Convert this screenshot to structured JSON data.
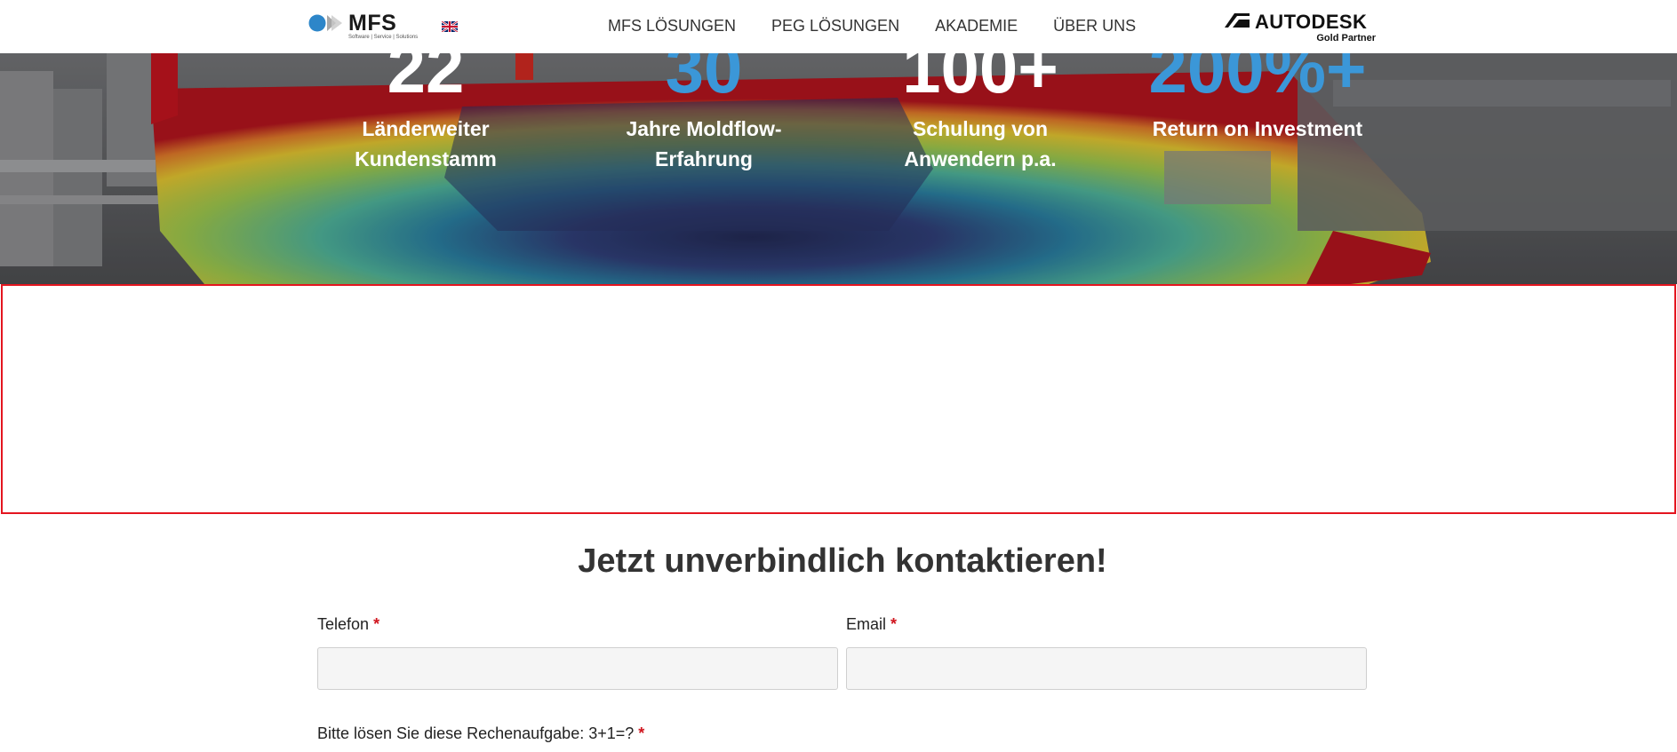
{
  "header": {
    "logo": {
      "text": "MFS",
      "tagline": "Software | Service | Solutions"
    },
    "language_flag": "uk-flag-icon",
    "nav": [
      {
        "label": "MFS LÖSUNGEN"
      },
      {
        "label": "PEG LÖSUNGEN"
      },
      {
        "label": "AKADEMIE"
      },
      {
        "label": "ÜBER UNS"
      }
    ],
    "partner": {
      "name": "AUTODESK",
      "subtitle": "Gold Partner"
    }
  },
  "hero": {
    "stats": [
      {
        "number": "22",
        "label": "Länderweiter Kundenstamm",
        "color": "#ffffff"
      },
      {
        "number": "30",
        "label": "Jahre Moldflow-Erfahrung",
        "color": "#3b97d8"
      },
      {
        "number": "100+",
        "label": "Schulung von Anwendern p.a.",
        "color": "#ffffff"
      },
      {
        "number": "200%+",
        "label": "Return on Investment",
        "color": "#3b97d8"
      }
    ]
  },
  "contact": {
    "title": "Jetzt unverbindlich kontaktieren!",
    "phone": {
      "label": "Telefon",
      "value": "",
      "placeholder": ""
    },
    "email": {
      "label": "Email",
      "value": "",
      "placeholder": ""
    },
    "captcha": {
      "label": "Bitte lösen Sie diese Rechenaufgabe: 3+1=?"
    },
    "required_marker": "*"
  },
  "colors": {
    "accent_blue": "#3b97d8",
    "required_red": "#d0161f",
    "highlight_border": "#e4151f"
  }
}
